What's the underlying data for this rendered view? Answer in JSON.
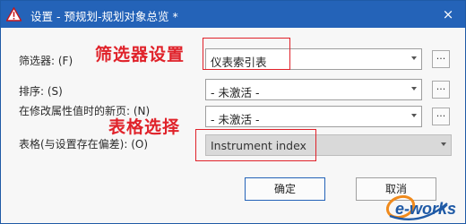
{
  "window": {
    "title": "设置 - 预规划-规划对象总览 *",
    "close_glyph": "×"
  },
  "annotations": {
    "filter_setting": "筛选器设置",
    "table_selection": "表格选择"
  },
  "form": {
    "filter": {
      "label": "筛选器: (F)",
      "value": "仪表索引表",
      "button": "..."
    },
    "sort": {
      "label": "排序: (S)",
      "value": "- 未激活 -",
      "button": "..."
    },
    "new_page": {
      "label": "在修改属性值时的新页: (N)",
      "value": "- 未激活 -",
      "button": "..."
    },
    "table": {
      "label": "表格(与设置存在偏差): (O)",
      "value": "Instrument index"
    }
  },
  "buttons": {
    "ok": "确定",
    "cancel": "取消"
  },
  "watermark": {
    "text": "e-works",
    "colors": {
      "orange": "#f08a1c",
      "blue": "#1f5aa6"
    }
  },
  "colors": {
    "titlebar": "#2463b8",
    "annotation_red": "#e0222a",
    "dialog_bg": "#f7f7f7"
  }
}
